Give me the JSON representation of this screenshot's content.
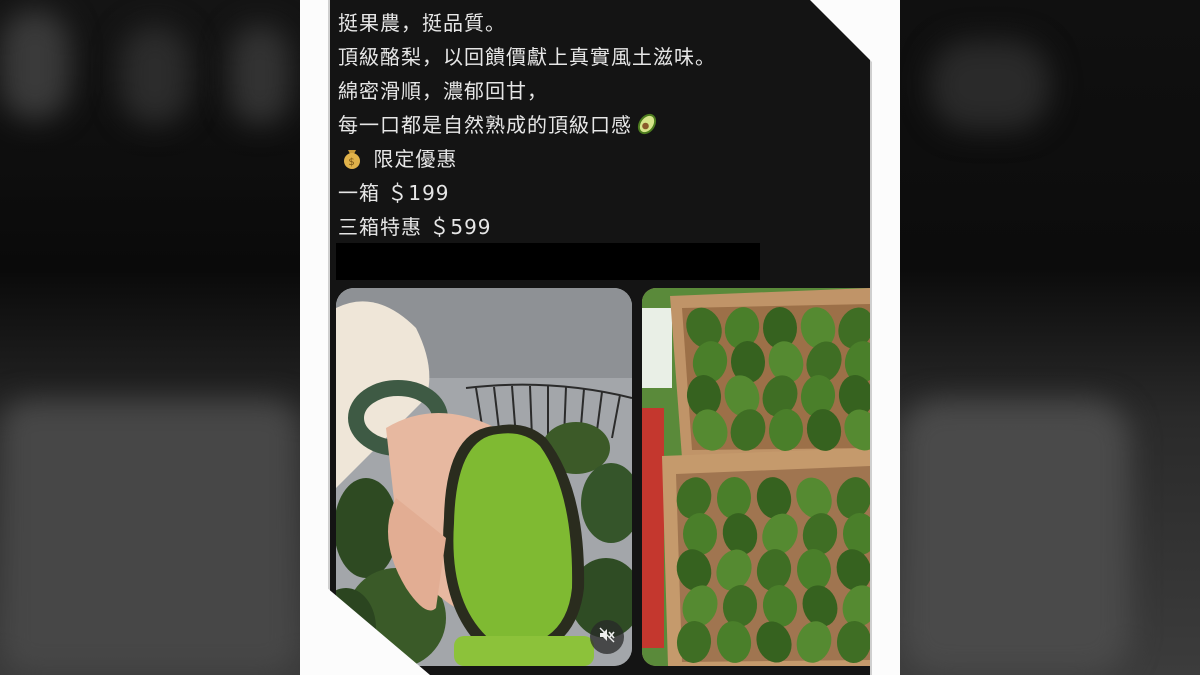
{
  "post": {
    "lines": [
      "挺果農，挺品質。",
      "頂級酪梨，以回饋價獻上真實風土滋味。",
      "綿密滑順，濃郁回甘，",
      "每一口都是自然熟成的頂級口感",
      "限定優惠",
      "一箱 ＄199",
      "三箱特惠 ＄599"
    ],
    "line4_emoji": "avocado-icon",
    "line5_emoji": "money-bag-icon"
  },
  "images": {
    "left": "hand-holding-halved-avocado-photo",
    "right": "boxes-of-avocados-photo"
  },
  "video": {
    "mute_icon": "muted-speaker-icon"
  },
  "colors": {
    "panel_bg": "#141414",
    "text": "#e6e6e6",
    "avocado_green": "#3e6e25",
    "avocado_flesh": "#7fba32",
    "box_cardboard": "#b88b5f"
  }
}
